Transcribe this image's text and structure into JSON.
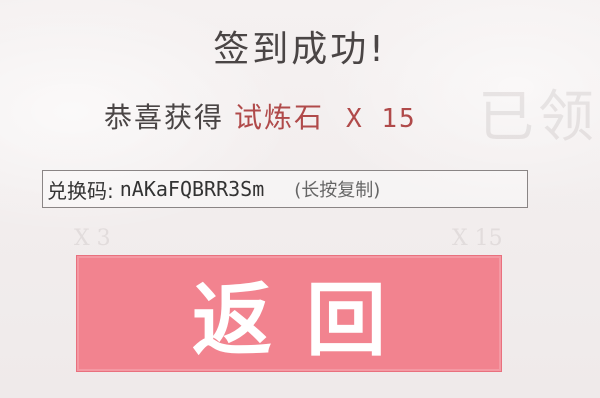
{
  "dialog": {
    "title": "签到成功!",
    "reward_prefix": "恭喜获得",
    "reward_item": "试炼石",
    "reward_qty": "X 15",
    "code_label": "兑换码:",
    "code_value": "nAKaFQBRR3Sm",
    "code_hint": "(长按复制)",
    "back_label": "返回"
  },
  "background": {
    "claimed_text": "已领",
    "qty_left": "X 3",
    "qty_right": "X 15"
  },
  "colors": {
    "accent": "#f2838f",
    "reward_text": "#b04a4a",
    "title_text": "#4a4545"
  }
}
